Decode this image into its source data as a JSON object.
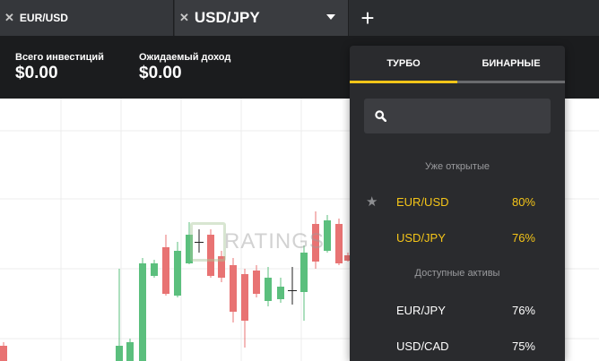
{
  "tabs": [
    {
      "label": "EUR/USD",
      "close_icon": "close-icon"
    },
    {
      "label": "USD/JPY",
      "close_icon": "close-icon",
      "dropdown_icon": "chevron-down-icon"
    }
  ],
  "add_tab_icon": "plus-icon",
  "summary": {
    "total_investments_label": "Всего инвестиций",
    "total_investments_value": "$0.00",
    "expected_income_label": "Ожидаемый доход",
    "expected_income_value": "$0.00"
  },
  "watermark": {
    "text": "RATINGS"
  },
  "asset_panel": {
    "tabs": [
      "ТУРБО",
      "БИНАРНЫЕ"
    ],
    "active_tab": "ТУРБО",
    "search": {
      "placeholder": "",
      "value": "",
      "icon": "search-icon"
    },
    "sections": {
      "opened_label": "Уже открытые",
      "available_label": "Доступные активы"
    },
    "opened": [
      {
        "name": "EUR/USD",
        "percent": "80%",
        "favorite": true
      },
      {
        "name": "USD/JPY",
        "percent": "76%",
        "favorite": false
      }
    ],
    "available": [
      {
        "name": "EUR/JPY",
        "percent": "76%"
      },
      {
        "name": "USD/CAD",
        "percent": "75%"
      }
    ]
  },
  "colors": {
    "accent_gold": "#f5c518",
    "candle_up": "#5bbf7d",
    "candle_down": "#e87373",
    "panel_bg": "#2a2b2e",
    "tabbar_bg": "#2b2d30"
  }
}
